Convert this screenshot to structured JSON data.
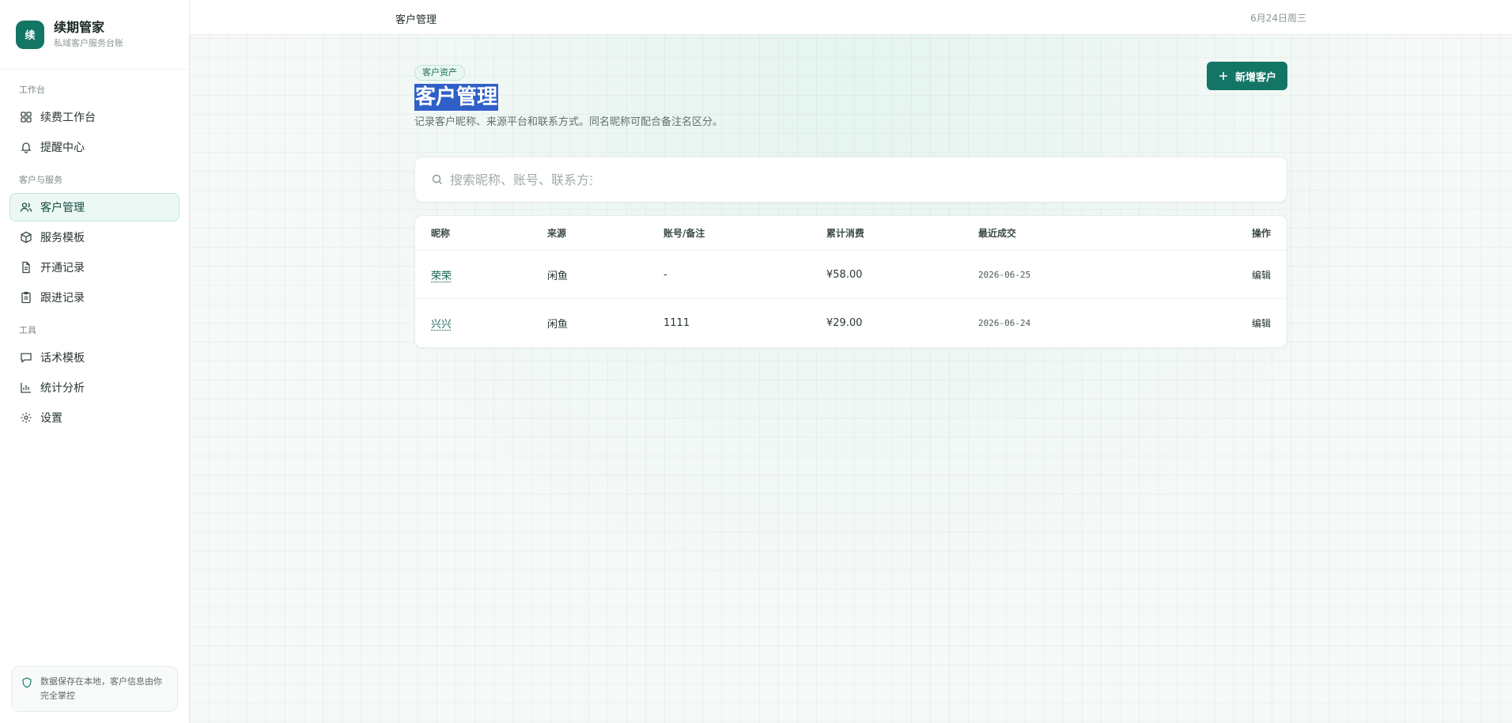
{
  "brand": {
    "logo_char": "续",
    "title": "续期管家",
    "subtitle": "私域客户服务台账"
  },
  "nav": {
    "groups": [
      {
        "label": "工作台",
        "items": [
          {
            "label": "续费工作台",
            "icon": "grid-icon"
          },
          {
            "label": "提醒中心",
            "icon": "bell-icon"
          }
        ]
      },
      {
        "label": "客户与服务",
        "items": [
          {
            "label": "客户管理",
            "icon": "users-icon",
            "active": true
          },
          {
            "label": "服务模板",
            "icon": "package-icon"
          },
          {
            "label": "开通记录",
            "icon": "file-icon"
          },
          {
            "label": "跟进记录",
            "icon": "clipboard-icon"
          }
        ]
      },
      {
        "label": "工具",
        "items": [
          {
            "label": "话术模板",
            "icon": "message-icon"
          },
          {
            "label": "统计分析",
            "icon": "bar-chart-icon"
          },
          {
            "label": "设置",
            "icon": "gear-icon"
          }
        ]
      }
    ]
  },
  "footer_note": "数据保存在本地，客户信息由你完全掌控",
  "topbar": {
    "breadcrumb": "客户管理",
    "date": "6月24日周三"
  },
  "page": {
    "tag": "客户资产",
    "title": "客户管理",
    "description": "记录客户昵称、来源平台和联系方式。同名昵称可配合备注名区分。",
    "add_button": "新增客户"
  },
  "search": {
    "placeholder": "搜索昵称、账号、联系方式",
    "value": ""
  },
  "table": {
    "headers": [
      "昵称",
      "来源",
      "账号/备注",
      "累计消费",
      "最近成交",
      "操作"
    ],
    "rows": [
      {
        "nickname": "荣荣",
        "source": "闲鱼",
        "account": "-",
        "total": "¥58.00",
        "last_deal": "2026-06-25",
        "action": "编辑"
      },
      {
        "nickname": "兴兴",
        "source": "闲鱼",
        "account": "1111",
        "total": "¥29.00",
        "last_deal": "2026-06-24",
        "action": "编辑"
      }
    ]
  },
  "colors": {
    "accent": "#137565",
    "active_bg": "#ebf8f3",
    "selection": "#2f5fc8"
  }
}
